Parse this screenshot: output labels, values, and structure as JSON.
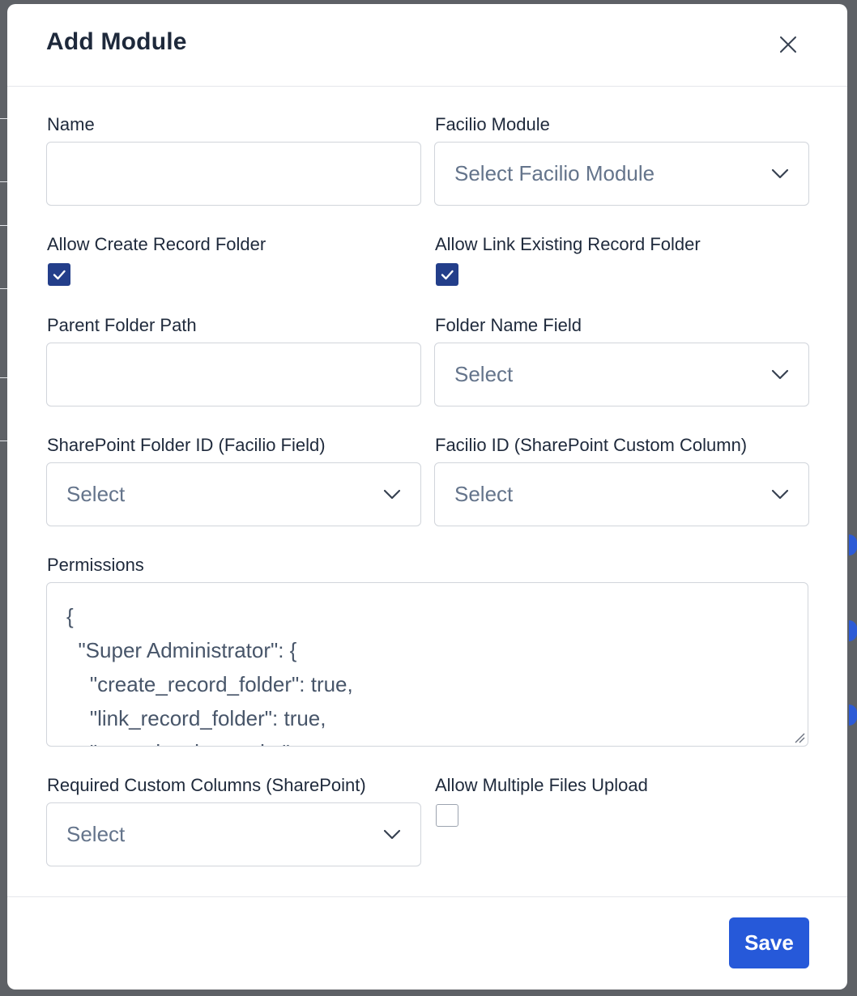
{
  "modal": {
    "title": "Add Module",
    "close_icon": "close-icon"
  },
  "form": {
    "name": {
      "label": "Name",
      "value": ""
    },
    "facilio_module": {
      "label": "Facilio Module",
      "selected": "Select Facilio Module"
    },
    "allow_create_record_folder": {
      "label": "Allow Create Record Folder",
      "checked": true
    },
    "allow_link_existing_record_folder": {
      "label": "Allow Link Existing Record Folder",
      "checked": true
    },
    "parent_folder_path": {
      "label": "Parent Folder Path",
      "value": ""
    },
    "folder_name_field": {
      "label": "Folder Name Field",
      "selected": "Select"
    },
    "sharepoint_folder_id": {
      "label": "SharePoint Folder ID (Facilio Field)",
      "selected": "Select"
    },
    "facilio_id_column": {
      "label": "Facilio ID (SharePoint Custom Column)",
      "selected": "Select"
    },
    "permissions": {
      "label": "Permissions",
      "value": "{\n  \"Super Administrator\": {\n    \"create_record_folder\": true,\n    \"link_record_folder\": true,\n    \"open_in_sharepoint\": true,"
    },
    "required_custom_columns": {
      "label": "Required Custom Columns (SharePoint)",
      "selected": "Select"
    },
    "allow_multiple_files_upload": {
      "label": "Allow Multiple Files Upload",
      "checked": false
    }
  },
  "footer": {
    "save_label": "Save"
  },
  "colors": {
    "primary_button": "#2659d9",
    "checkbox_checked": "#233e8a",
    "overlay": "#5e6166"
  }
}
